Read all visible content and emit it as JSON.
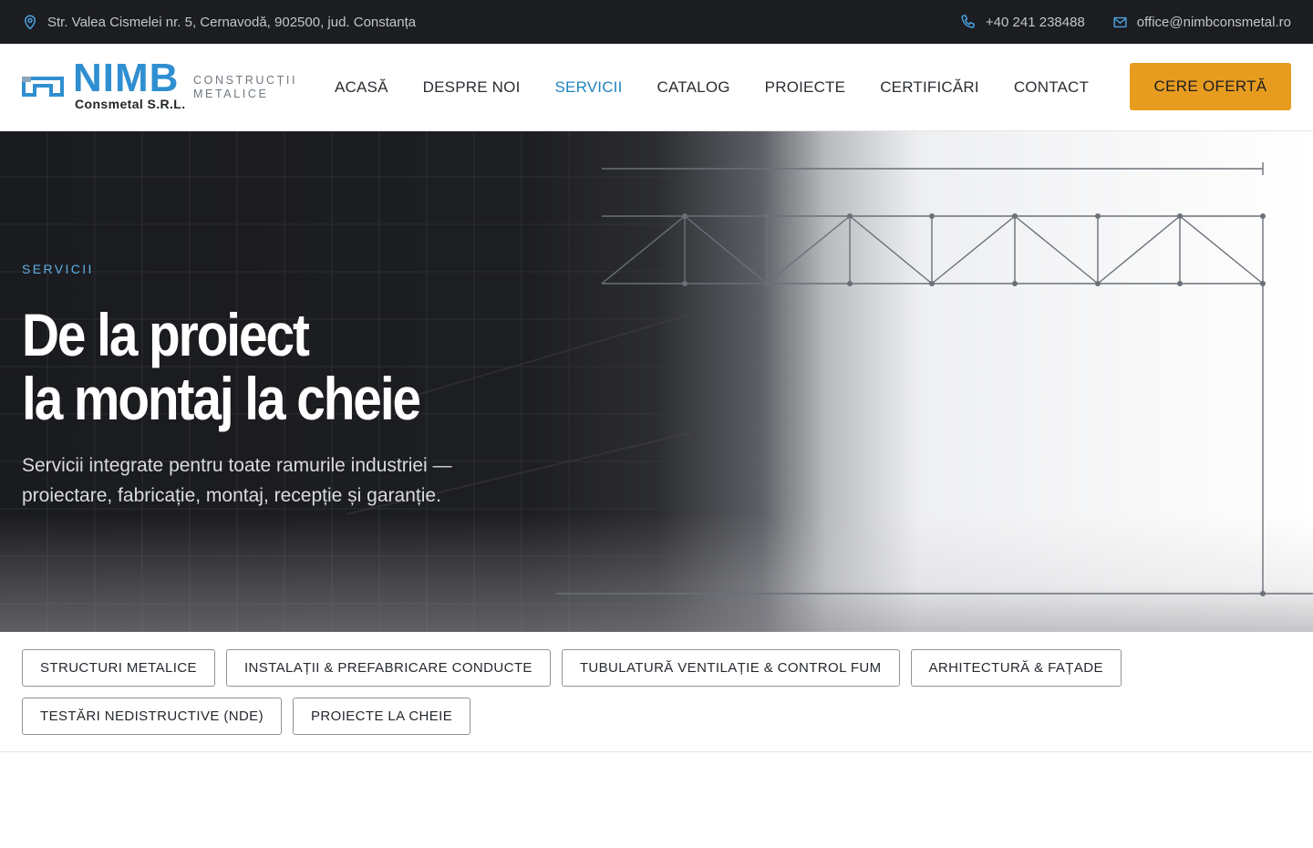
{
  "topbar": {
    "address": "Str. Valea Cismelei nr. 5, Cernavodă, 902500, jud. Constanța",
    "phone": "+40 241 238488",
    "email": "office@nimbconsmetal.ro",
    "icons": [
      "map-pin-icon",
      "phone-icon",
      "mail-icon"
    ]
  },
  "logo": {
    "name": "NIMB",
    "company": "Consmetal S.R.L.",
    "tagline_line1": "CONSTRUCȚII",
    "tagline_line2": "METALICE"
  },
  "nav": {
    "items": [
      {
        "label": "ACASĂ",
        "active": false
      },
      {
        "label": "DESPRE NOI",
        "active": false
      },
      {
        "label": "SERVICII",
        "active": true
      },
      {
        "label": "CATALOG",
        "active": false
      },
      {
        "label": "PROIECTE",
        "active": false
      },
      {
        "label": "CERTIFICĂRI",
        "active": false
      },
      {
        "label": "CONTACT",
        "active": false
      }
    ],
    "cta_label": "CERE OFERTĂ"
  },
  "hero": {
    "eyebrow": "SERVICII",
    "title_line1": "De la proiect",
    "title_line2": "la montaj la cheie",
    "lead": "Servicii integrate pentru toate ramurile industriei — proiectare, fabricație, montaj, recepție și garanție."
  },
  "service_tags": [
    "STRUCTURI METALICE",
    "INSTALAȚII & PREFABRICARE CONDUCTE",
    "TUBULATURĂ VENTILAȚIE & CONTROL FUM",
    "ARHITECTURĂ & FAȚADE",
    "TESTĂRI NEDISTRUCTIVE (NDE)",
    "PROIECTE LA CHEIE"
  ],
  "colors": {
    "accent": "#2f8fd1",
    "nav_active": "#1f84c0",
    "cta": "#e89c1f",
    "topbar_bg": "#1c1d21"
  }
}
